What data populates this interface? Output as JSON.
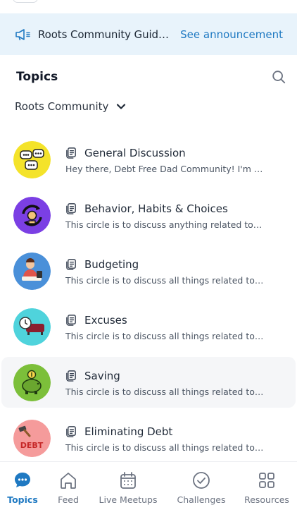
{
  "announcement": {
    "title": "Roots Community Guidelines",
    "link_label": "See announcement"
  },
  "topics": {
    "heading": "Topics",
    "community": "Roots Community"
  },
  "circles": [
    {
      "title": "General Discussion",
      "description": "Hey there, Debt Free Dad Community! I'm Alex and I'm excited to have you here",
      "avatar": "speech-bubbles-icon",
      "color": "#f4e32a"
    },
    {
      "title": "Behavior, Habits & Choices",
      "description": "This circle is to discuss anything related to our behavior and habits",
      "avatar": "cycle-arrows-icon",
      "color": "#7b3fe4"
    },
    {
      "title": "Budgeting",
      "description": "This circle is to discuss all things related to the budget",
      "avatar": "person-calculator-icon",
      "color": "#4a90d9"
    },
    {
      "title": "Excuses",
      "description": "This circle is to discuss all things related to Excuses",
      "avatar": "clock-couch-icon",
      "color": "#4fd3dc"
    },
    {
      "title": "Saving",
      "description": "This circle is to discuss all things related to the saving",
      "avatar": "piggy-bank-icon",
      "color": "#7cbf3a"
    },
    {
      "title": "Eliminating Debt",
      "description": "This circle is to discuss all things related to the debt",
      "avatar": "hammer-debt-icon",
      "color": "#f59b9b",
      "badge_text": "DEBT"
    }
  ],
  "tabs": [
    {
      "label": "Topics",
      "icon": "chat-bubble-icon",
      "active": true
    },
    {
      "label": "Feed",
      "icon": "home-icon",
      "active": false
    },
    {
      "label": "Live Meetups",
      "icon": "calendar-icon",
      "active": false
    },
    {
      "label": "Challenges",
      "icon": "check-circle-icon",
      "active": false
    },
    {
      "label": "Resources",
      "icon": "grid-icon",
      "active": false
    }
  ],
  "colors": {
    "accent": "#1f79c2",
    "banner_bg": "#e8f3fb",
    "selected_row_bg": "#f5f6f8"
  }
}
